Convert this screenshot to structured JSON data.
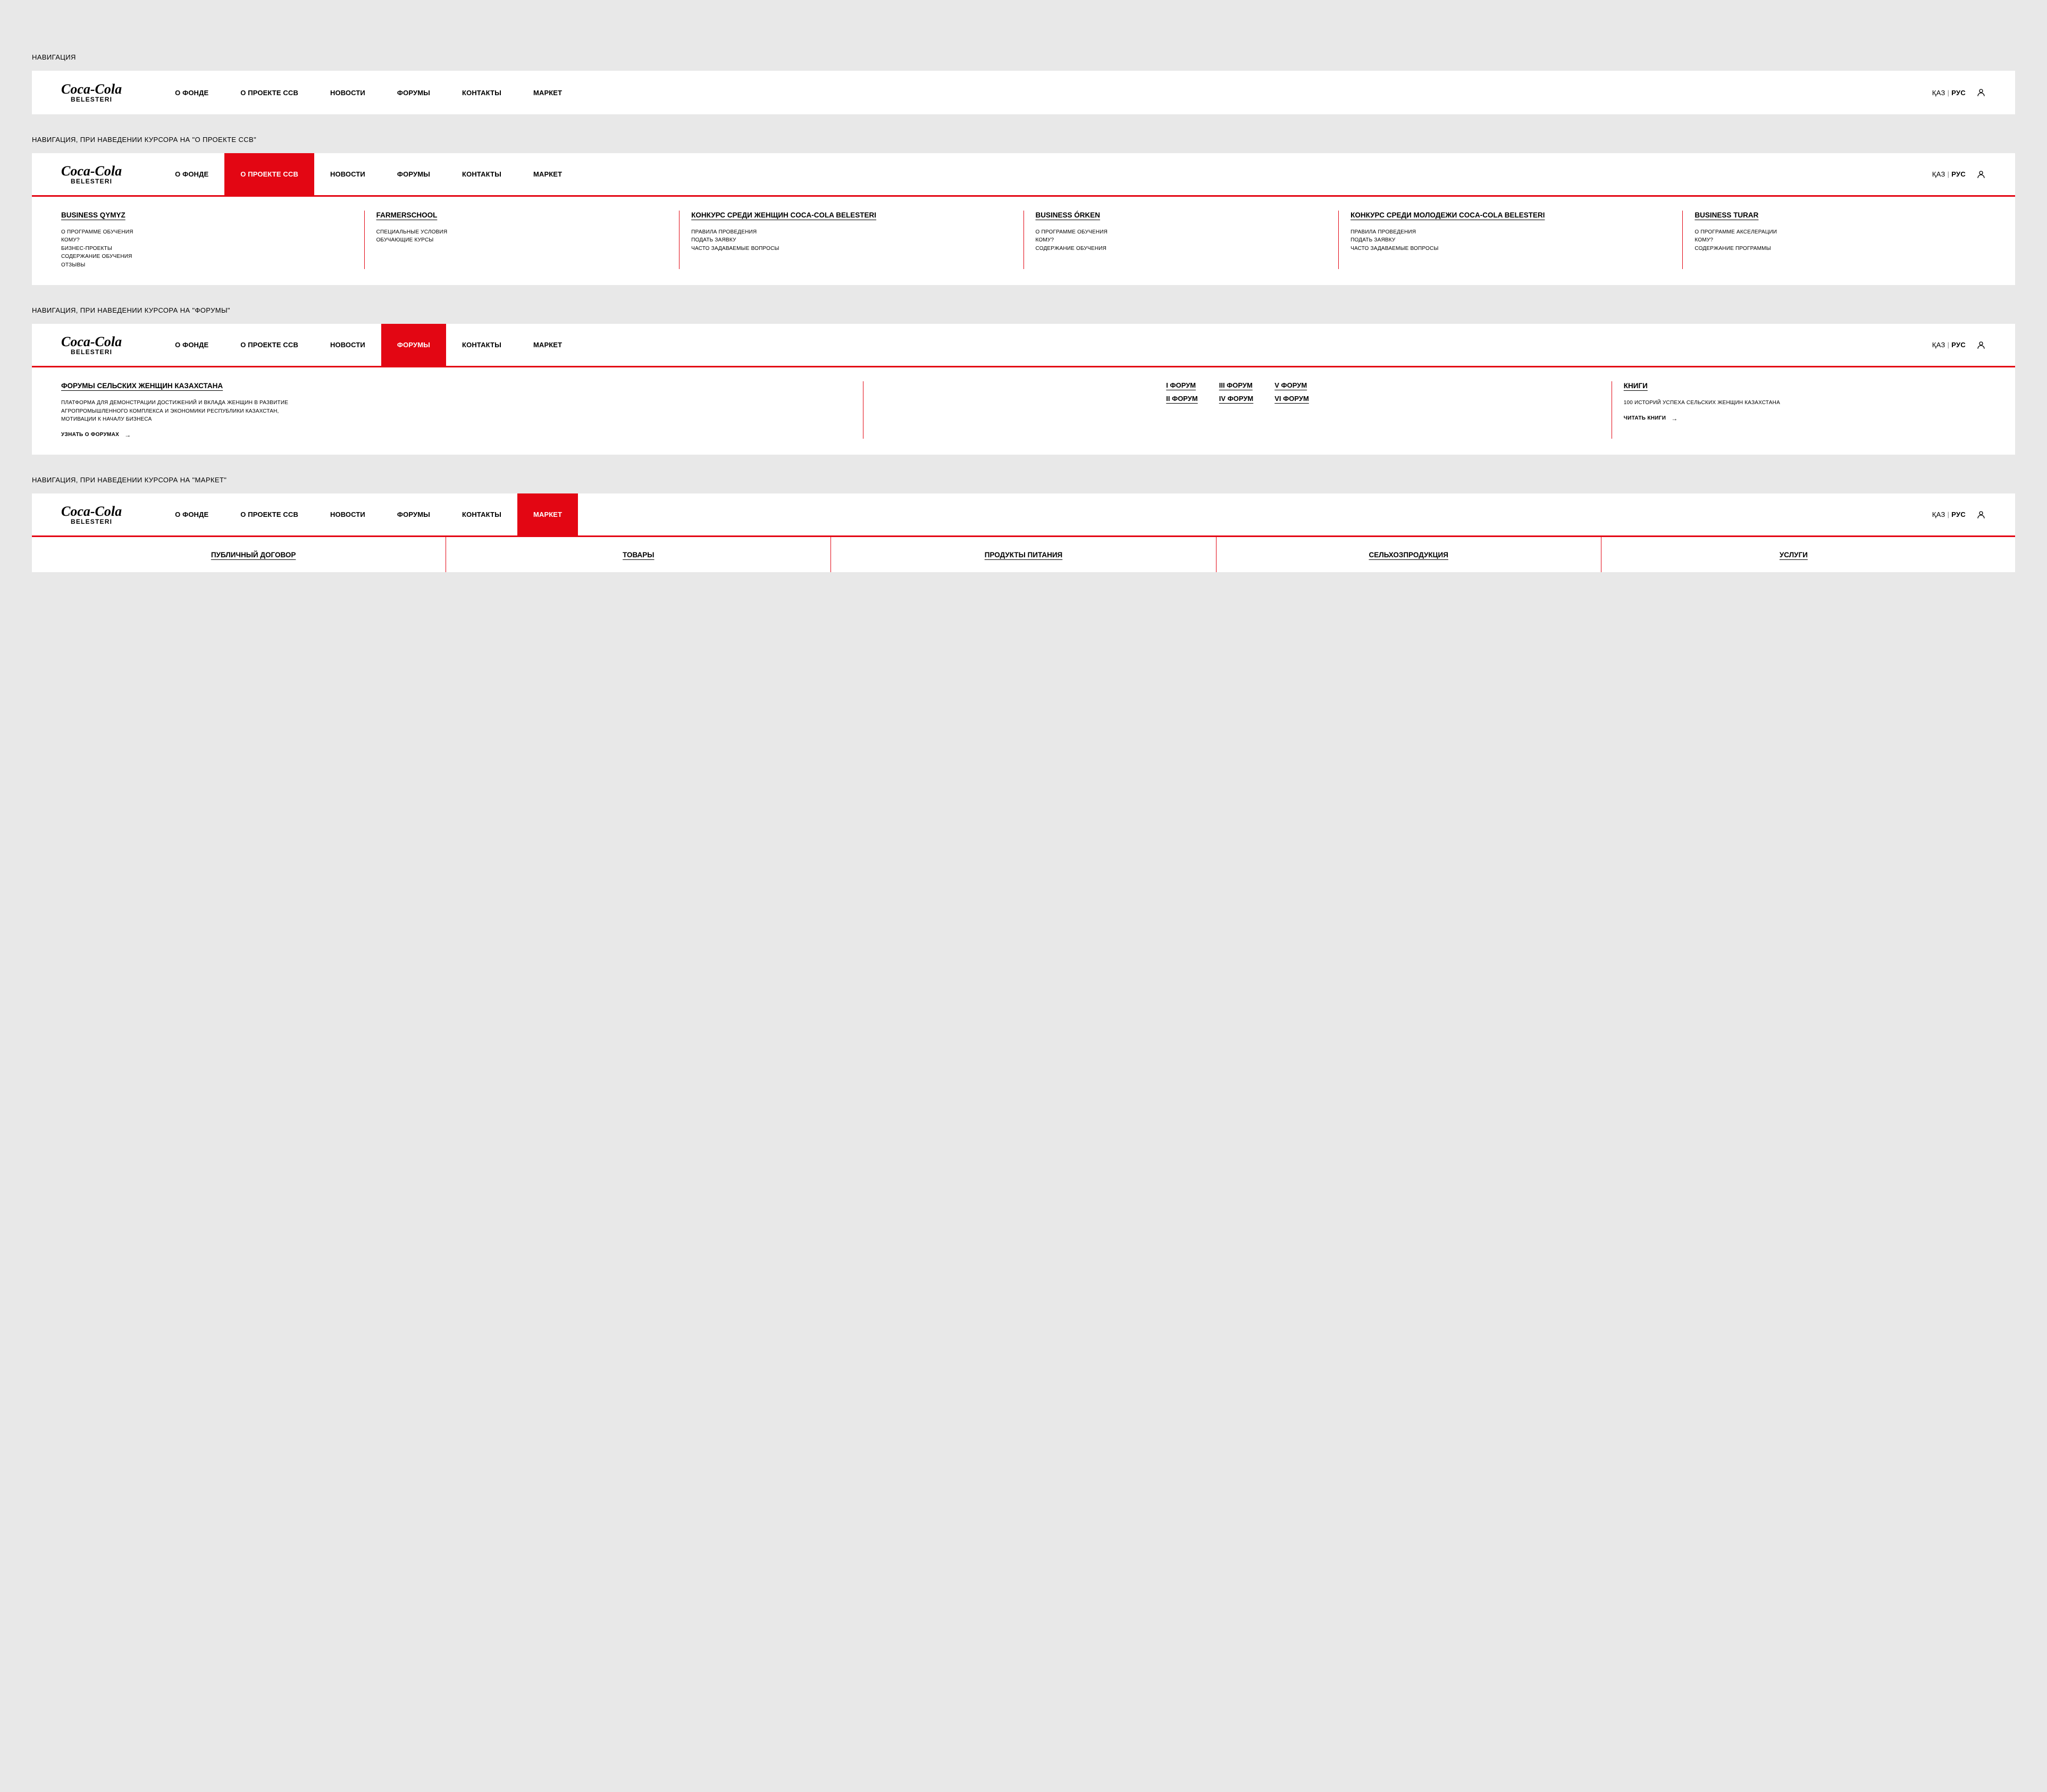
{
  "labels": {
    "basic": "НАВИГАЦИЯ",
    "project": "НАВИГАЦИЯ, ПРИ НАВЕДЕНИИ КУРСОРА НА \"О ПРОЕКТЕ CCB\"",
    "forums": "НАВИГАЦИЯ, ПРИ НАВЕДЕНИИ КУРСОРА НА \"ФОРУМЫ\"",
    "market": "НАВИГАЦИЯ, ПРИ НАВЕДЕНИИ КУРСОРА НА \"МАРКЕТ\""
  },
  "logo": {
    "script": "Coca-Cola",
    "sub": "BELESTERI"
  },
  "menu": [
    "О ФОНДЕ",
    "О ПРОЕКТЕ CCB",
    "НОВОСТИ",
    "ФОРУМЫ",
    "КОНТАКТЫ",
    "МАРКЕТ"
  ],
  "lang": {
    "kz": "ҚАЗ",
    "ru": "РУС",
    "sep": "|"
  },
  "project_panel": [
    {
      "title": "BUSINESS QYMYZ",
      "items": [
        "О ПРОГРАММЕ ОБУЧЕНИЯ",
        "КОМУ?",
        "БИЗНЕС-ПРОЕКТЫ",
        "СОДЕРЖАНИЕ ОБУЧЕНИЯ",
        "ОТЗЫВЫ"
      ]
    },
    {
      "title": "FARMERSCHOOL",
      "items": [
        "СПЕЦИАЛЬНЫЕ УСЛОВИЯ",
        "ОБУЧАЮЩИЕ КУРСЫ"
      ]
    },
    {
      "title": "КОНКУРС СРЕДИ ЖЕНЩИН COCA-COLA BELESTERI",
      "items": [
        "ПРАВИЛА ПРОВЕДЕНИЯ",
        "ПОДАТЬ ЗАЯВКУ",
        "ЧАСТО ЗАДАВАЕМЫЕ ВОПРОСЫ"
      ]
    },
    {
      "title": "BUSINESS ÓRKEN",
      "items": [
        "О ПРОГРАММЕ ОБУЧЕНИЯ",
        "КОМУ?",
        "СОДЕРЖАНИЕ ОБУЧЕНИЯ"
      ]
    },
    {
      "title": "КОНКУРС СРЕДИ МОЛОДЕЖИ COCA-COLA BELESTERI",
      "items": [
        "ПРАВИЛА ПРОВЕДЕНИЯ",
        "ПОДАТЬ ЗАЯВКУ",
        "ЧАСТО ЗАДАВАЕМЫЕ ВОПРОСЫ"
      ]
    },
    {
      "title": "BUSINESS TURAR",
      "items": [
        "О ПРОГРАММЕ АКСЕЛЕРАЦИИ",
        "КОМУ?",
        "СОДЕРЖАНИЕ ПРОГРАММЫ"
      ]
    }
  ],
  "forums_panel": {
    "heading": "ФОРУМЫ СЕЛЬСКИХ ЖЕНЩИН КАЗАХСТАНА",
    "desc": "ПЛАТФОРМА ДЛЯ ДЕМОНСТРАЦИИ ДОСТИЖЕНИЙ И ВКЛАДА ЖЕНЩИН В РАЗВИТИЕ АГРОПРОМЫШЛЕННОГО КОМПЛЕКСА И ЭКОНОМИКИ РЕСПУБЛИКИ КАЗАХСТАН, МОТИВАЦИИ К НАЧАЛУ БИЗНЕСА",
    "more": "УЗНАТЬ О ФОРУМАХ",
    "links": [
      "I ФОРУМ",
      "III ФОРУМ",
      "V  ФОРУМ",
      "II ФОРУМ",
      "IV ФОРУМ",
      "VI ФОРУМ"
    ],
    "books_title": "КНИГИ",
    "books_desc": "100 ИСТОРИЙ УСПЕХА СЕЛЬСКИХ ЖЕНЩИН КАЗАХСТАНА",
    "books_more": "ЧИТАТЬ КНИГИ"
  },
  "market_panel": [
    "ПУБЛИЧНЫЙ ДОГОВОР",
    "ТОВАРЫ",
    "ПРОДУКТЫ ПИТАНИЯ",
    "СЕЛЬХОЗПРОДУКЦИЯ",
    "УСЛУГИ"
  ],
  "colors": {
    "accent": "#e30613",
    "bg": "#e8e8e8"
  }
}
